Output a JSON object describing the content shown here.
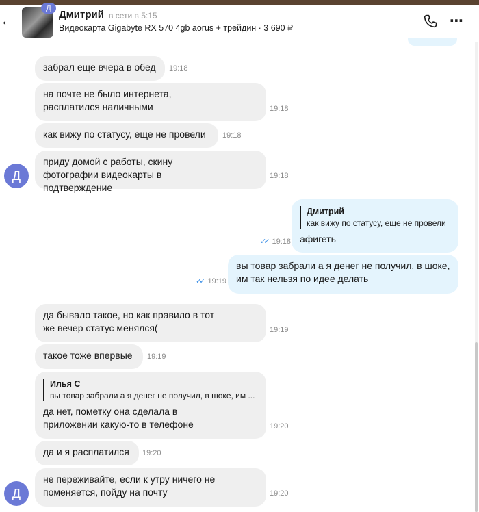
{
  "header": {
    "name": "Дмитрий",
    "status": "в сети в 5:15",
    "item": "Видеокарта Gigabyte RX 570 4gb aorus + трейдин · 3 690 ₽",
    "thumb_badge": "Д",
    "icons": {
      "back": "arrow-left-icon",
      "call": "phone-icon",
      "more": "more-icon"
    }
  },
  "avatar_letter": "Д",
  "messages": [
    {
      "dir": "in",
      "text": "забрал еще вчера в обед",
      "time": "19:18"
    },
    {
      "dir": "in",
      "text": "на почте не было интернета, расплатился наличными",
      "time": "19:18"
    },
    {
      "dir": "in",
      "text": "как вижу по статусу, еще не провели",
      "time": "19:18"
    },
    {
      "dir": "in",
      "text": "приду домой с работы, скину фотографии видеокарты в подтверждение",
      "time": "19:18"
    },
    {
      "dir": "out",
      "quote_author": "Дмитрий",
      "quote_text": "как вижу по статусу, еще не провели",
      "text": "афигеть",
      "time": "19:18"
    },
    {
      "dir": "out",
      "text": "вы товар забрали а я денег не получил, в шоке, им так нельзя по идее делать",
      "time": "19:19"
    },
    {
      "dir": "in",
      "text": "да бывало такое, но как правило в тот же вечер статус менялся(",
      "time": "19:19"
    },
    {
      "dir": "in",
      "text": "такое тоже впервые",
      "time": "19:19"
    },
    {
      "dir": "in",
      "quote_author": "Илья С",
      "quote_text": "вы товар забрали а я денег не получил, в шоке, им ...",
      "text": "да нет, пометку она сделала в приложении какую-то в телефоне",
      "time": "19:20"
    },
    {
      "dir": "in",
      "text": "да и я расплатился",
      "time": "19:20"
    },
    {
      "dir": "in",
      "text": "не переживайте, если к утру ничего не поменяется, пойду на почту",
      "time": "19:20"
    }
  ]
}
